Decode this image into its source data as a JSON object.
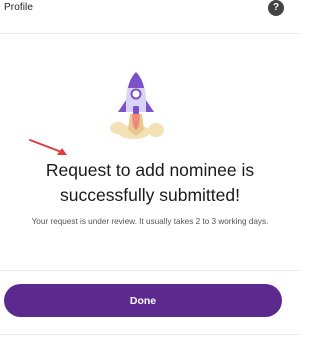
{
  "header": {
    "title": "Profile",
    "help_glyph": "?",
    "help_icon": "help-icon"
  },
  "illustration": {
    "icon": "rocket-launch-icon",
    "colors": {
      "rocket_body": "#d8d2f4",
      "rocket_accent": "#7b52c7",
      "flame": "#e8c990",
      "smoke": "#f2e2b6",
      "flame_core": "#f08a7b"
    }
  },
  "annotation": {
    "icon": "red-arrow-icon",
    "color": "#e23b3b"
  },
  "message": {
    "title_line1": "Request to add nominee is",
    "title_line2": "successfully submitted!",
    "subtitle": "Your request is under review. It usually takes 2 to 3 working days."
  },
  "actions": {
    "done_label": "Done"
  },
  "theme": {
    "accent": "#5c2a8f",
    "background": "#ffffff",
    "divider": "#ececec"
  }
}
